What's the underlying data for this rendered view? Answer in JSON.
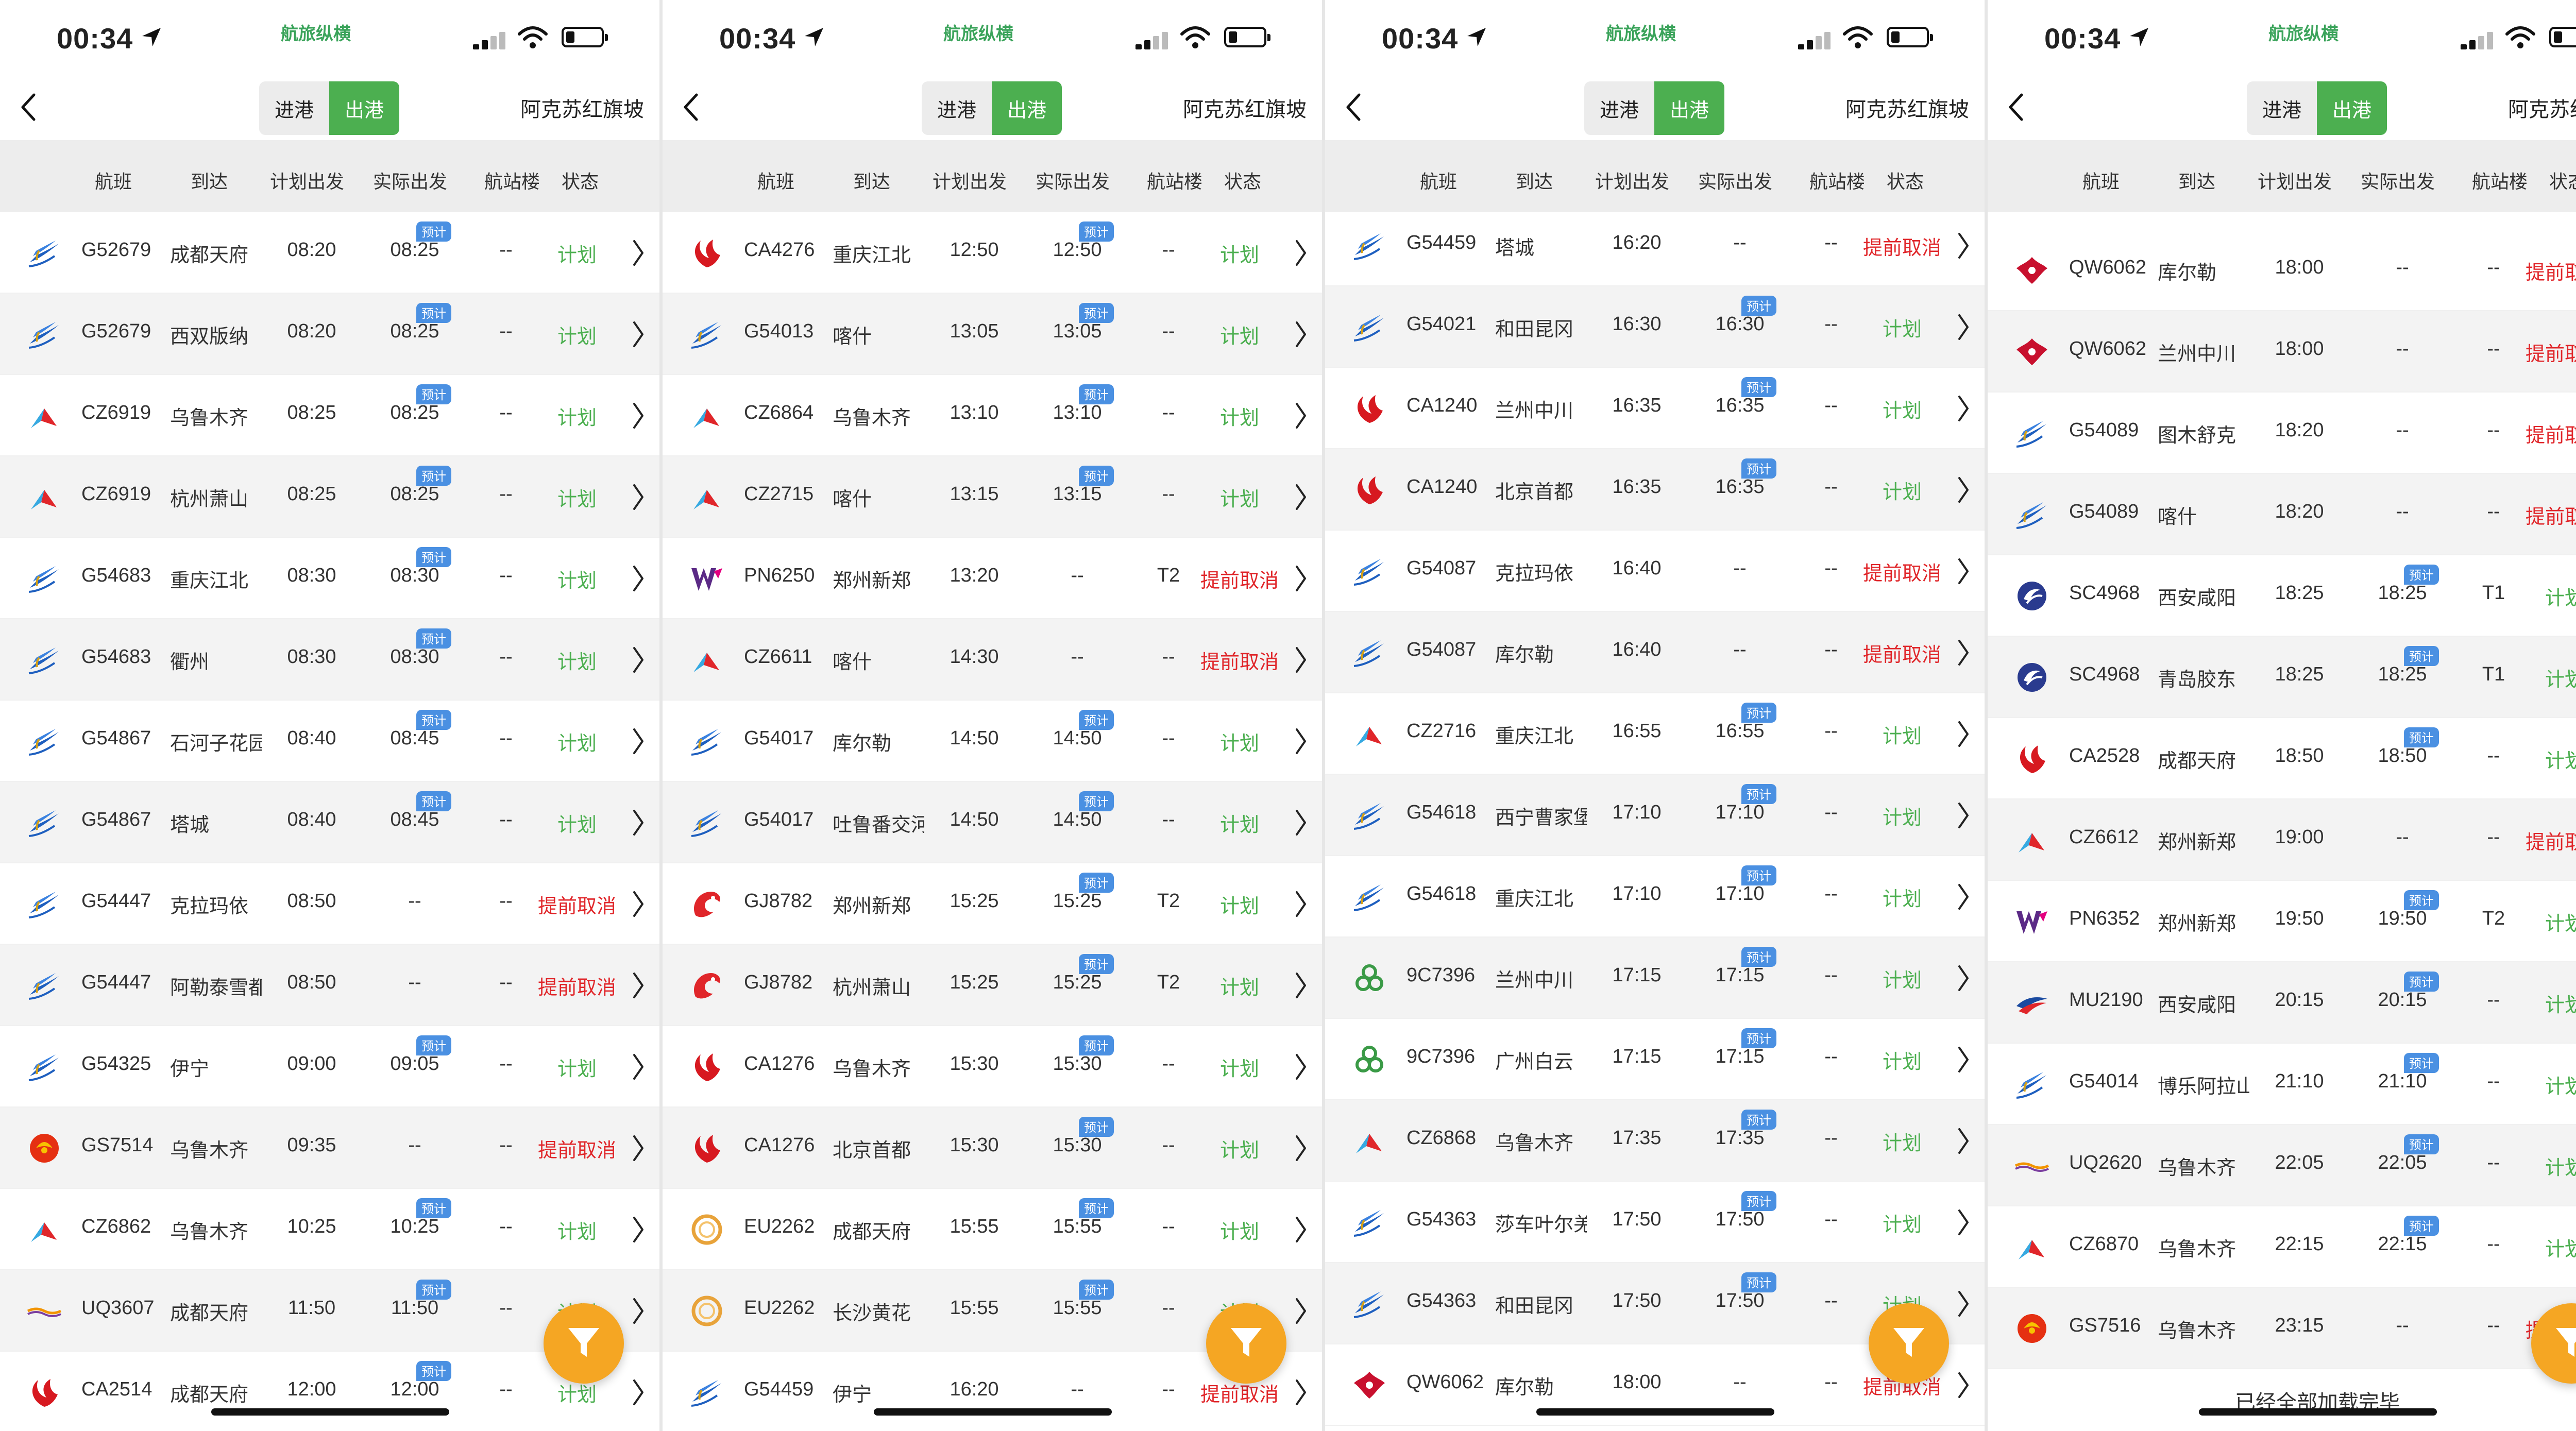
{
  "status_bar": {
    "time": "00:34",
    "brand": "航旅纵横"
  },
  "nav": {
    "tab_in": "进港",
    "tab_out": "出港",
    "airport": "阿克苏红旗坡"
  },
  "columns": [
    "航班",
    "到达",
    "计划出发",
    "实际出发",
    "航站楼",
    "状态"
  ],
  "badge_text": "预计",
  "footer_text": "已经全部加载完毕",
  "colors": {
    "plan": "#4caf50",
    "cancel": "#e0262a",
    "badge": "#4a90e2",
    "filter": "#f5a623",
    "active_tab": "#4caf50"
  },
  "panels": [
    {
      "rows": [
        {
          "airline": "tianjin",
          "flight": "G52679",
          "dest": "成都天府",
          "planned": "08:20",
          "actual": "08:25",
          "terminal": "--",
          "status": "计划",
          "badge": true
        },
        {
          "airline": "tianjin",
          "flight": "G52679",
          "dest": "西双版纳",
          "planned": "08:20",
          "actual": "08:25",
          "terminal": "--",
          "status": "计划",
          "badge": true
        },
        {
          "airline": "southern",
          "flight": "CZ6919",
          "dest": "乌鲁木齐",
          "planned": "08:25",
          "actual": "08:25",
          "terminal": "--",
          "status": "计划",
          "badge": true
        },
        {
          "airline": "southern",
          "flight": "CZ6919",
          "dest": "杭州萧山",
          "planned": "08:25",
          "actual": "08:25",
          "terminal": "--",
          "status": "计划",
          "badge": true
        },
        {
          "airline": "tianjin",
          "flight": "G54683",
          "dest": "重庆江北",
          "planned": "08:30",
          "actual": "08:30",
          "terminal": "--",
          "status": "计划",
          "badge": true
        },
        {
          "airline": "tianjin",
          "flight": "G54683",
          "dest": "衢州",
          "planned": "08:30",
          "actual": "08:30",
          "terminal": "--",
          "status": "计划",
          "badge": true
        },
        {
          "airline": "tianjin",
          "flight": "G54867",
          "dest": "石河子花园",
          "planned": "08:40",
          "actual": "08:45",
          "terminal": "--",
          "status": "计划",
          "badge": true
        },
        {
          "airline": "tianjin",
          "flight": "G54867",
          "dest": "塔城",
          "planned": "08:40",
          "actual": "08:45",
          "terminal": "--",
          "status": "计划",
          "badge": true
        },
        {
          "airline": "tianjin",
          "flight": "G54447",
          "dest": "克拉玛依",
          "planned": "08:50",
          "actual": "--",
          "terminal": "--",
          "status": "提前取消",
          "badge": false
        },
        {
          "airline": "tianjin",
          "flight": "G54447",
          "dest": "阿勒泰雪都",
          "planned": "08:50",
          "actual": "--",
          "terminal": "--",
          "status": "提前取消",
          "badge": false
        },
        {
          "airline": "tianjin",
          "flight": "G54325",
          "dest": "伊宁",
          "planned": "09:00",
          "actual": "09:05",
          "terminal": "--",
          "status": "计划",
          "badge": true
        },
        {
          "airline": "hainan",
          "flight": "GS7514",
          "dest": "乌鲁木齐",
          "planned": "09:35",
          "actual": "--",
          "terminal": "--",
          "status": "提前取消",
          "badge": false
        },
        {
          "airline": "southern",
          "flight": "CZ6862",
          "dest": "乌鲁木齐",
          "planned": "10:25",
          "actual": "10:25",
          "terminal": "--",
          "status": "计划",
          "badge": true
        },
        {
          "airline": "urumqi",
          "flight": "UQ3607",
          "dest": "成都天府",
          "planned": "11:50",
          "actual": "11:50",
          "terminal": "--",
          "status": "计划",
          "badge": true
        },
        {
          "airline": "airchina",
          "flight": "CA2514",
          "dest": "成都天府",
          "planned": "12:00",
          "actual": "12:00",
          "terminal": "--",
          "status": "计划",
          "badge": true
        }
      ]
    },
    {
      "rows": [
        {
          "airline": "airchina",
          "flight": "CA4276",
          "dest": "重庆江北",
          "planned": "12:50",
          "actual": "12:50",
          "terminal": "--",
          "status": "计划",
          "badge": true
        },
        {
          "airline": "tianjin",
          "flight": "G54013",
          "dest": "喀什",
          "planned": "13:05",
          "actual": "13:05",
          "terminal": "--",
          "status": "计划",
          "badge": true
        },
        {
          "airline": "southern",
          "flight": "CZ6864",
          "dest": "乌鲁木齐",
          "planned": "13:10",
          "actual": "13:10",
          "terminal": "--",
          "status": "计划",
          "badge": true
        },
        {
          "airline": "southern",
          "flight": "CZ2715",
          "dest": "喀什",
          "planned": "13:15",
          "actual": "13:15",
          "terminal": "--",
          "status": "计划",
          "badge": true
        },
        {
          "airline": "westair",
          "flight": "PN6250",
          "dest": "郑州新郑",
          "planned": "13:20",
          "actual": "--",
          "terminal": "T2",
          "status": "提前取消",
          "badge": false
        },
        {
          "airline": "southern",
          "flight": "CZ6611",
          "dest": "喀什",
          "planned": "14:30",
          "actual": "--",
          "terminal": "--",
          "status": "提前取消",
          "badge": false
        },
        {
          "airline": "tianjin",
          "flight": "G54017",
          "dest": "库尔勒",
          "planned": "14:50",
          "actual": "14:50",
          "terminal": "--",
          "status": "计划",
          "badge": true
        },
        {
          "airline": "tianjin",
          "flight": "G54017",
          "dest": "吐鲁番交河",
          "planned": "14:50",
          "actual": "14:50",
          "terminal": "--",
          "status": "计划",
          "badge": true
        },
        {
          "airline": "chongqing",
          "flight": "GJ8782",
          "dest": "郑州新郑",
          "planned": "15:25",
          "actual": "15:25",
          "terminal": "T2",
          "status": "计划",
          "badge": true
        },
        {
          "airline": "chongqing",
          "flight": "GJ8782",
          "dest": "杭州萧山",
          "planned": "15:25",
          "actual": "15:25",
          "terminal": "T2",
          "status": "计划",
          "badge": true
        },
        {
          "airline": "airchina",
          "flight": "CA1276",
          "dest": "乌鲁木齐",
          "planned": "15:30",
          "actual": "15:30",
          "terminal": "--",
          "status": "计划",
          "badge": true
        },
        {
          "airline": "airchina",
          "flight": "CA1276",
          "dest": "北京首都",
          "planned": "15:30",
          "actual": "15:30",
          "terminal": "--",
          "status": "计划",
          "badge": true
        },
        {
          "airline": "eu",
          "flight": "EU2262",
          "dest": "成都天府",
          "planned": "15:55",
          "actual": "15:55",
          "terminal": "--",
          "status": "计划",
          "badge": true
        },
        {
          "airline": "eu",
          "flight": "EU2262",
          "dest": "长沙黄花",
          "planned": "15:55",
          "actual": "15:55",
          "terminal": "--",
          "status": "计划",
          "badge": true
        },
        {
          "airline": "tianjin",
          "flight": "G54459",
          "dest": "伊宁",
          "planned": "16:20",
          "actual": "--",
          "terminal": "--",
          "status": "提前取消",
          "badge": false
        }
      ]
    },
    {
      "rows": [
        {
          "airline": "tianjin",
          "flight": "G54459",
          "dest": "塔城",
          "planned": "16:20",
          "actual": "--",
          "terminal": "--",
          "status": "提前取消",
          "badge": false
        },
        {
          "airline": "tianjin",
          "flight": "G54021",
          "dest": "和田昆冈",
          "planned": "16:30",
          "actual": "16:30",
          "terminal": "--",
          "status": "计划",
          "badge": true
        },
        {
          "airline": "airchina",
          "flight": "CA1240",
          "dest": "兰州中川",
          "planned": "16:35",
          "actual": "16:35",
          "terminal": "--",
          "status": "计划",
          "badge": true
        },
        {
          "airline": "airchina",
          "flight": "CA1240",
          "dest": "北京首都",
          "planned": "16:35",
          "actual": "16:35",
          "terminal": "--",
          "status": "计划",
          "badge": true
        },
        {
          "airline": "tianjin",
          "flight": "G54087",
          "dest": "克拉玛依",
          "planned": "16:40",
          "actual": "--",
          "terminal": "--",
          "status": "提前取消",
          "badge": false
        },
        {
          "airline": "tianjin",
          "flight": "G54087",
          "dest": "库尔勒",
          "planned": "16:40",
          "actual": "--",
          "terminal": "--",
          "status": "提前取消",
          "badge": false
        },
        {
          "airline": "southern",
          "flight": "CZ2716",
          "dest": "重庆江北",
          "planned": "16:55",
          "actual": "16:55",
          "terminal": "--",
          "status": "计划",
          "badge": true
        },
        {
          "airline": "tianjin",
          "flight": "G54618",
          "dest": "西宁曹家堡",
          "planned": "17:10",
          "actual": "17:10",
          "terminal": "--",
          "status": "计划",
          "badge": true
        },
        {
          "airline": "tianjin",
          "flight": "G54618",
          "dest": "重庆江北",
          "planned": "17:10",
          "actual": "17:10",
          "terminal": "--",
          "status": "计划",
          "badge": true
        },
        {
          "airline": "springs",
          "flight": "9C7396",
          "dest": "兰州中川",
          "planned": "17:15",
          "actual": "17:15",
          "terminal": "--",
          "status": "计划",
          "badge": true
        },
        {
          "airline": "springs",
          "flight": "9C7396",
          "dest": "广州白云",
          "planned": "17:15",
          "actual": "17:15",
          "terminal": "--",
          "status": "计划",
          "badge": true
        },
        {
          "airline": "southern",
          "flight": "CZ6868",
          "dest": "乌鲁木齐",
          "planned": "17:35",
          "actual": "17:35",
          "terminal": "--",
          "status": "计划",
          "badge": true
        },
        {
          "airline": "tianjin",
          "flight": "G54363",
          "dest": "莎车叶尔羌",
          "planned": "17:50",
          "actual": "17:50",
          "terminal": "--",
          "status": "计划",
          "badge": true
        },
        {
          "airline": "tianjin",
          "flight": "G54363",
          "dest": "和田昆冈",
          "planned": "17:50",
          "actual": "17:50",
          "terminal": "--",
          "status": "计划",
          "badge": true
        },
        {
          "airline": "qingdao",
          "flight": "QW6062",
          "dest": "库尔勒",
          "planned": "18:00",
          "actual": "--",
          "terminal": "--",
          "status": "提前取消",
          "badge": false
        }
      ]
    },
    {
      "rows": [
        {
          "airline": "qingdao",
          "flight": "QW6062",
          "dest": "库尔勒",
          "planned": "18:00",
          "actual": "--",
          "terminal": "--",
          "status": "提前取消",
          "badge": false
        },
        {
          "airline": "qingdao",
          "flight": "QW6062",
          "dest": "兰州中川",
          "planned": "18:00",
          "actual": "--",
          "terminal": "--",
          "status": "提前取消",
          "badge": false
        },
        {
          "airline": "tianjin",
          "flight": "G54089",
          "dest": "图木舒克",
          "planned": "18:20",
          "actual": "--",
          "terminal": "--",
          "status": "提前取消",
          "badge": false
        },
        {
          "airline": "tianjin",
          "flight": "G54089",
          "dest": "喀什",
          "planned": "18:20",
          "actual": "--",
          "terminal": "--",
          "status": "提前取消",
          "badge": false
        },
        {
          "airline": "sichuan",
          "flight": "SC4968",
          "dest": "西安咸阳",
          "planned": "18:25",
          "actual": "18:25",
          "terminal": "T1",
          "status": "计划",
          "badge": true
        },
        {
          "airline": "sichuan",
          "flight": "SC4968",
          "dest": "青岛胶东",
          "planned": "18:25",
          "actual": "18:25",
          "terminal": "T1",
          "status": "计划",
          "badge": true
        },
        {
          "airline": "airchina",
          "flight": "CA2528",
          "dest": "成都天府",
          "planned": "18:50",
          "actual": "18:50",
          "terminal": "--",
          "status": "计划",
          "badge": true
        },
        {
          "airline": "southern",
          "flight": "CZ6612",
          "dest": "郑州新郑",
          "planned": "19:00",
          "actual": "--",
          "terminal": "--",
          "status": "提前取消",
          "badge": false
        },
        {
          "airline": "westair",
          "flight": "PN6352",
          "dest": "郑州新郑",
          "planned": "19:50",
          "actual": "19:50",
          "terminal": "T2",
          "status": "计划",
          "badge": true
        },
        {
          "airline": "eastern",
          "flight": "MU2190",
          "dest": "西安咸阳",
          "planned": "20:15",
          "actual": "20:15",
          "terminal": "--",
          "status": "计划",
          "badge": true
        },
        {
          "airline": "tianjin",
          "flight": "G54014",
          "dest": "博乐阿拉山口",
          "planned": "21:10",
          "actual": "21:10",
          "terminal": "--",
          "status": "计划",
          "badge": true
        },
        {
          "airline": "urumqi",
          "flight": "UQ2620",
          "dest": "乌鲁木齐",
          "planned": "22:05",
          "actual": "22:05",
          "terminal": "--",
          "status": "计划",
          "badge": true
        },
        {
          "airline": "southern",
          "flight": "CZ6870",
          "dest": "乌鲁木齐",
          "planned": "22:15",
          "actual": "22:15",
          "terminal": "--",
          "status": "计划",
          "badge": true
        },
        {
          "airline": "hainan",
          "flight": "GS7516",
          "dest": "乌鲁木齐",
          "planned": "23:15",
          "actual": "--",
          "terminal": "--",
          "status": "提前取消",
          "badge": false
        }
      ]
    }
  ]
}
